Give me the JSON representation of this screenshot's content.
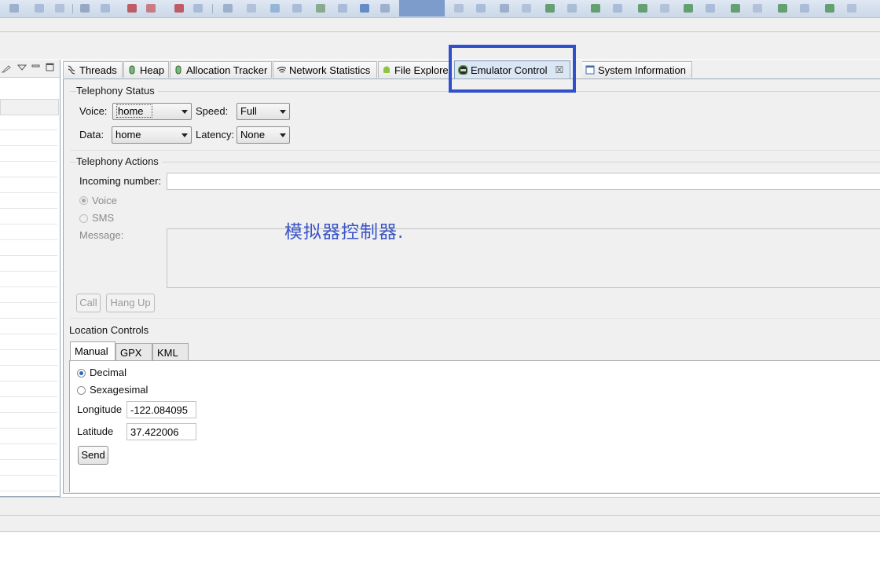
{
  "tabs": [
    {
      "label": "Threads",
      "icon": "threads-icon"
    },
    {
      "label": "Heap",
      "icon": "heap-icon"
    },
    {
      "label": "Allocation Tracker",
      "icon": "allocation-tracker-icon"
    },
    {
      "label": "Network Statistics",
      "icon": "network-statistics-icon"
    },
    {
      "label": "File Explore",
      "icon": "android-icon"
    },
    {
      "label": "Emulator Control",
      "icon": "emulator-control-icon",
      "active": true,
      "close": "☒"
    },
    {
      "label": "System Information",
      "icon": "system-information-icon"
    }
  ],
  "telephony_status": {
    "title": "Telephony Status",
    "voice_label": "Voice:",
    "voice_value": "home",
    "speed_label": "Speed:",
    "speed_value": "Full",
    "data_label": "Data:",
    "data_value": "home",
    "latency_label": "Latency:",
    "latency_value": "None"
  },
  "telephony_actions": {
    "title": "Telephony Actions",
    "incoming_label": "Incoming number:",
    "incoming_value": "",
    "voice_radio": "Voice",
    "sms_radio": "SMS",
    "message_label": "Message:",
    "call_button": "Call",
    "hangup_button": "Hang Up"
  },
  "annotation": "模拟器控制器.",
  "location": {
    "title": "Location Controls",
    "tabs": [
      "Manual",
      "GPX",
      "KML"
    ],
    "decimal_radio": "Decimal",
    "sexagesimal_radio": "Sexagesimal",
    "longitude_label": "Longitude",
    "longitude_value": "-122.084095",
    "latitude_label": "Latitude",
    "latitude_value": "37.422006",
    "send_button": "Send"
  },
  "colors": {
    "highlight": "#2f4fcc",
    "annotation": "#3a55c9",
    "active_tab": "#dbe6f4"
  }
}
